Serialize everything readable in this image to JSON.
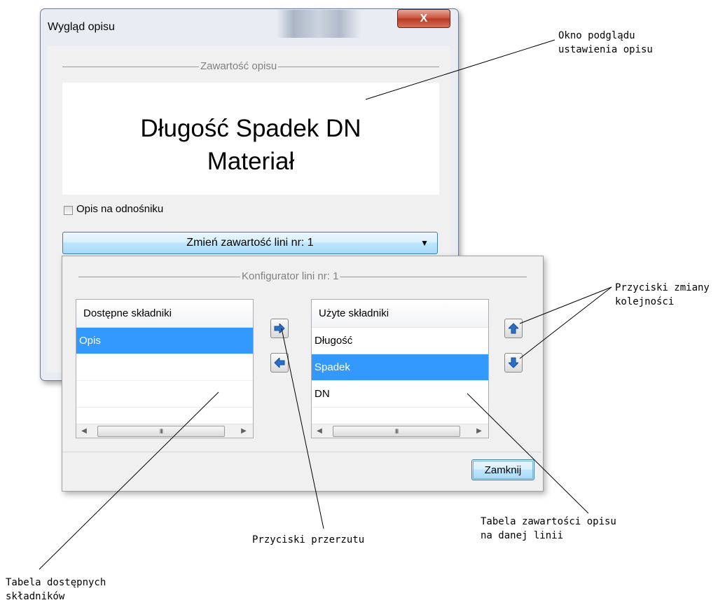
{
  "window1": {
    "title": "Wygląd opisu",
    "close_label": "X",
    "group_label": "Zawartość opisu",
    "preview_line1": "Długość Spadek DN",
    "preview_line2": "Materiał",
    "checkbox_label": "Opis na odnośniku",
    "checkbox_checked": false,
    "dropdown_label": "Zmień zawartość lini nr: 1"
  },
  "window2": {
    "group_label": "Konfigurator lini nr: 1",
    "available": {
      "header": "Dostępne składniki",
      "rows": [
        "Opis"
      ],
      "selected_index": 0
    },
    "used": {
      "header": "Użyte składniki",
      "rows": [
        "Długość",
        "Spadek",
        "DN"
      ],
      "selected_index": 1
    },
    "scroll_thumb": "III",
    "close_button": "Zamknij"
  },
  "icons": {
    "transfer_right": "arrow-right-icon",
    "transfer_left": "arrow-left-icon",
    "move_up": "arrow-up-icon",
    "move_down": "arrow-down-icon",
    "accent_blue": "#2a6fc6",
    "selection_color": "#3399ff"
  },
  "annotations": {
    "preview_window": [
      "Okno podglądu",
      "ustawienia opisu"
    ],
    "order_buttons": [
      "Przyciski zmiany",
      "kolejności"
    ],
    "transfer_buttons": [
      "Przyciski przerzutu"
    ],
    "used_table": [
      "Tabela zawartości opisu",
      "na danej linii"
    ],
    "available_table": [
      "Tabela dostępnych",
      "składników"
    ]
  }
}
